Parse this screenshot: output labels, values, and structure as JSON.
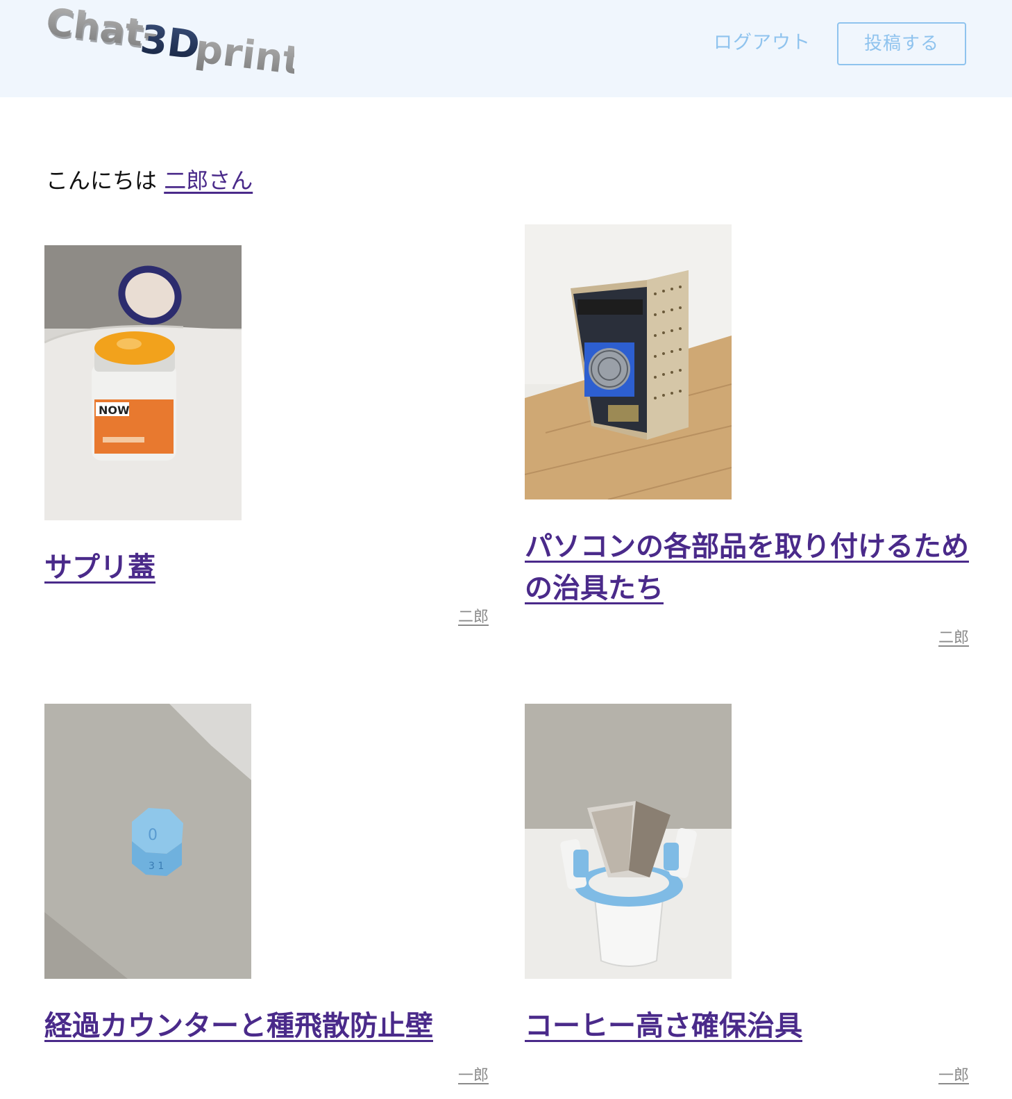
{
  "header": {
    "logo_text_1": "Chat-",
    "logo_text_2": "3D",
    "logo_text_3": "print",
    "logout_label": "ログアウト",
    "post_label": "投稿する"
  },
  "greeting": {
    "prefix": "こんにちは",
    "user_link": "二郎さん"
  },
  "posts": [
    {
      "title": "サプリ蓋",
      "author": "二郎",
      "image": "supplement-bottle-photo"
    },
    {
      "title": "パソコンの各部品を取り付けるための治具たち",
      "author": "二郎",
      "image": "pc-case-photo"
    },
    {
      "title": "経過カウンターと種飛散防止壁",
      "author": "一郎",
      "image": "counter-dial-photo"
    },
    {
      "title": "コーヒー高さ確保治具",
      "author": "一郎",
      "image": "coffee-holder-photo"
    }
  ],
  "colors": {
    "header_bg": "#f0f6fd",
    "header_accent": "#8fc3ee",
    "link": "#4a2a8a",
    "muted": "#8a8a8a"
  }
}
